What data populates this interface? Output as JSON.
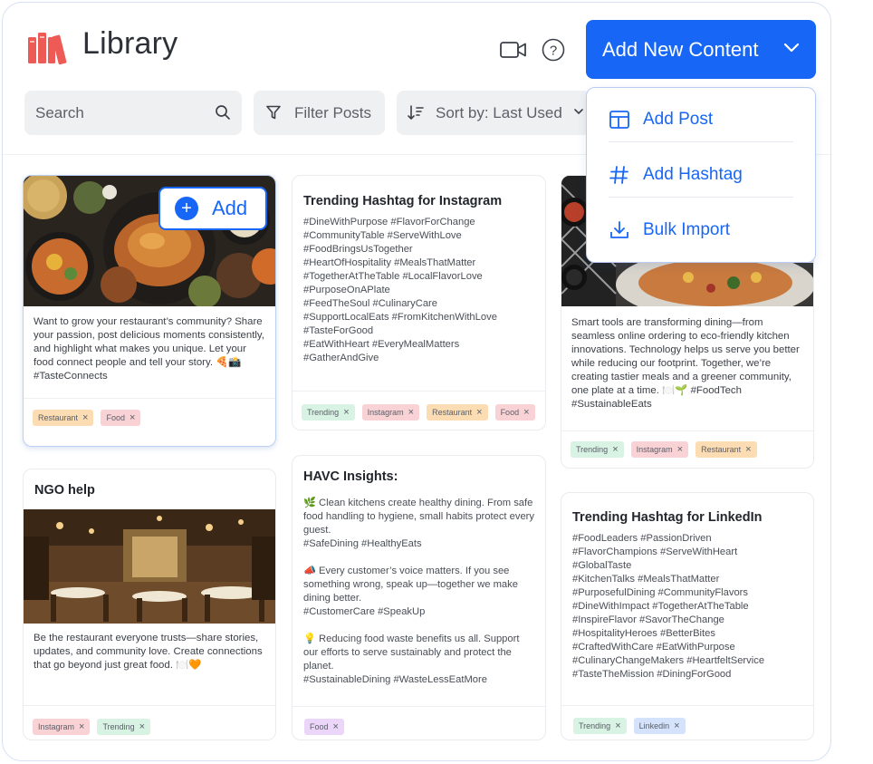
{
  "header": {
    "title": "Library",
    "add_new_label": "Add New Content",
    "brand_color": "#1766f6"
  },
  "toolbar": {
    "search_placeholder": "Search",
    "filter_label": "Filter Posts",
    "sort_label": "Sort by: Last Used"
  },
  "dropdown": {
    "items": [
      {
        "label": "Add Post",
        "icon": "layout-icon"
      },
      {
        "label": "Add Hashtag",
        "icon": "hash-icon"
      },
      {
        "label": "Bulk Import",
        "icon": "download-icon"
      }
    ]
  },
  "add_button_label": "Add",
  "cards": [
    {
      "text": "Want to grow your restaurant’s community? Share your passion, post delicious moments consistently, and highlight what makes you unique. Let your food connect people and tell your story. 🍕📸 #TasteConnects",
      "tags": [
        "Restaurant",
        "Food"
      ]
    },
    {
      "title": "Trending Hashtag for Instagram",
      "hashtags": "#DineWithPurpose #FlavorForChange\n#CommunityTable #ServeWithLove\n#FoodBringsUsTogether\n#HeartOfHospitality #MealsThatMatter\n#TogetherAtTheTable #LocalFlavorLove\n#PurposeOnAPlate\n#FeedTheSoul #CulinaryCare\n#SupportLocalEats #FromKitchenWithLove\n#TasteForGood\n#EatWithHeart #EveryMealMatters\n#GatherAndGive",
      "tags": [
        "Trending",
        "Instagram",
        "Restaurant",
        "Food"
      ]
    },
    {
      "text": "Smart tools are transforming dining—from seamless online ordering to eco-friendly kitchen innovations. Technology helps us serve you better while reducing our footprint. Together, we’re creating tastier meals and a greener community, one plate at a time. 🍽️🌱 #FoodTech #SustainableEats",
      "tags": [
        "Trending",
        "Instagram",
        "Restaurant"
      ]
    },
    {
      "title": "NGO help",
      "text": "Be the restaurant everyone trusts—share stories, updates, and community love. Create connections that go beyond just great food. 🍽️🧡",
      "tags": [
        "Instagram",
        "Trending"
      ]
    },
    {
      "title": "HAVC Insights:",
      "paragraphs": [
        "🌿 Clean kitchens create healthy dining. From safe food handling to hygiene, small habits protect every guest.\n#SafeDining #HealthyEats",
        "📣 Every customer’s voice matters. If you see something wrong, speak up—together we make dining better.\n#CustomerCare #SpeakUp",
        "💡 Reducing food waste benefits us all. Support our efforts to serve sustainably and protect the planet.\n#SustainableDining #WasteLessEatMore"
      ],
      "tags": [
        "Food"
      ]
    },
    {
      "title": "Trending Hashtag for LinkedIn",
      "hashtags": "#FoodLeaders #PassionDriven\n#FlavorChampions #ServeWithHeart\n#GlobalTaste\n#KitchenTalks #MealsThatMatter\n#PurposefulDining #CommunityFlavors\n#DineWithImpact #TogetherAtTheTable\n#InspireFlavor #SavorTheChange\n#HospitalityHeroes #BetterBites\n#CraftedWithCare #EatWithPurpose\n#CulinaryChangeMakers #HeartfeltService\n#TasteTheMission #DiningForGood",
      "tags": [
        "Trending",
        "Linkedin"
      ]
    }
  ],
  "tag_colors": {
    "Restaurant": "#fbdcb3",
    "Food": "#f9d2d6",
    "Trending": "#d8f2e4",
    "Instagram": "#f9d2d6",
    "Linkedin": "#d4e2fb"
  }
}
